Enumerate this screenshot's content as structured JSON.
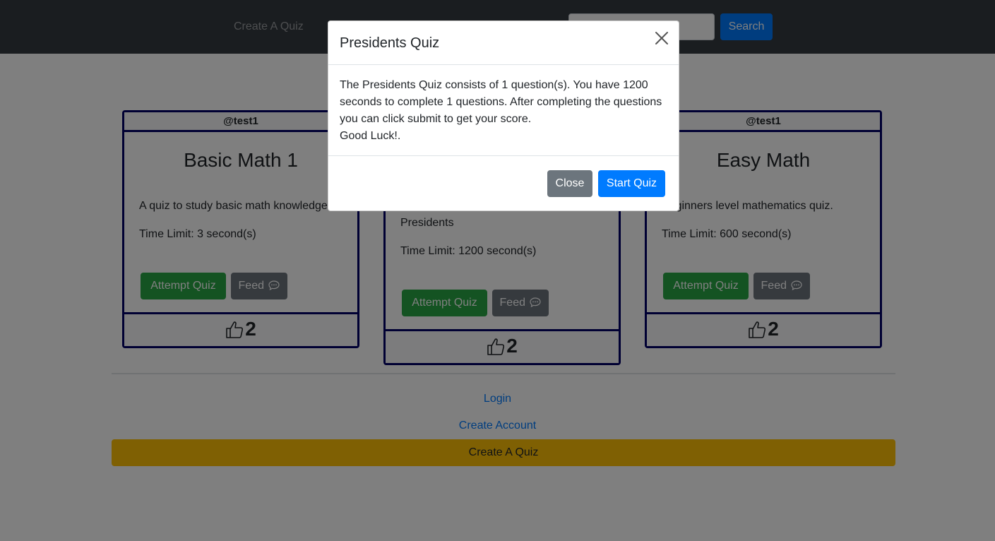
{
  "navbar": {
    "create_quiz_link": "Create A Quiz",
    "search_placeholder": "",
    "search_button": "Search"
  },
  "cards": [
    {
      "author": "@test1",
      "title": "Basic Math 1",
      "description": "A quiz to study basic math knowledge",
      "time_limit": "Time Limit: 3 second(s)",
      "attempt_label": "Attempt Quiz",
      "feed_label": "Feed",
      "likes": "2"
    },
    {
      "author": "",
      "title": "",
      "description": "Presidents",
      "time_limit": "Time Limit: 1200 second(s)",
      "attempt_label": "Attempt Quiz",
      "feed_label": "Feed",
      "likes": "2"
    },
    {
      "author": "@test1",
      "title": "Easy Math",
      "description": "Beginners level mathematics quiz.",
      "time_limit": "Time Limit: 600 second(s)",
      "attempt_label": "Attempt Quiz",
      "feed_label": "Feed",
      "likes": "2"
    }
  ],
  "footer": {
    "login": "Login",
    "create_account": "Create Account",
    "create_quiz": "Create A Quiz"
  },
  "modal": {
    "title": "Presidents Quiz",
    "body_line1": "The Presidents Quiz consists of 1 question(s). You have 1200 seconds to complete 1 questions. After completing the questions you can click submit to get your score.",
    "body_line2": "Good Luck!.",
    "close_label": "Close",
    "start_label": "Start Quiz"
  },
  "colors": {
    "navbar": "#343a40",
    "primary": "#007bff",
    "success": "#28a745",
    "secondary": "#6c757d",
    "warning": "#ffc107",
    "card_border": "#000066"
  },
  "icons": {
    "close": "close-icon",
    "feed": "chat-dots-icon",
    "like": "thumbs-up-icon"
  }
}
